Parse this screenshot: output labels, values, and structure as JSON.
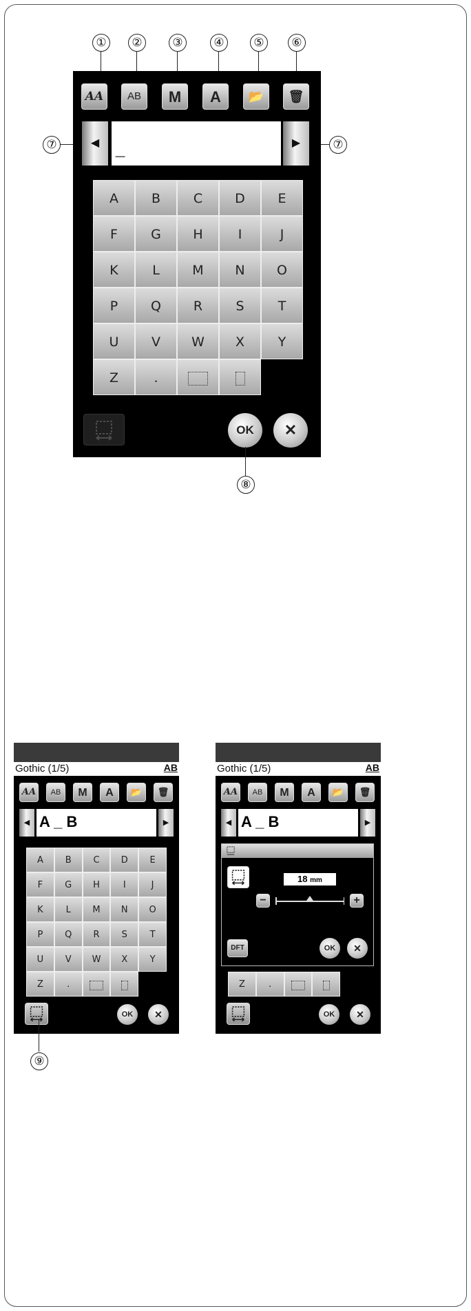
{
  "callouts": [
    "①",
    "②",
    "③",
    "④",
    "⑤",
    "⑥",
    "⑦",
    "⑧",
    "⑨"
  ],
  "icons": {
    "font": "AA",
    "case": "AB",
    "size": "M",
    "letter": "A",
    "folder": "📂",
    "delete": "🗑"
  },
  "keyboard": {
    "rows": [
      [
        "A",
        "B",
        "C",
        "D",
        "E"
      ],
      [
        "F",
        "G",
        "H",
        "I",
        "J"
      ],
      [
        "K",
        "L",
        "M",
        "N",
        "O"
      ],
      [
        "P",
        "Q",
        "R",
        "S",
        "T"
      ],
      [
        "U",
        "V",
        "W",
        "X",
        "Y"
      ],
      [
        "Z",
        "."
      ]
    ]
  },
  "buttons": {
    "ok": "OK",
    "cancel": "✕",
    "left_arrow": "◀",
    "right_arrow": "▶",
    "dft": "DFT",
    "minus": "−",
    "plus": "+"
  },
  "text_input": {
    "value_main": "_",
    "value_small": "A _ B"
  },
  "small_screen": {
    "title": "Gothic (1/5)",
    "title_icon": "AB"
  },
  "spacing_dialog": {
    "value": "18",
    "unit": "mm"
  }
}
